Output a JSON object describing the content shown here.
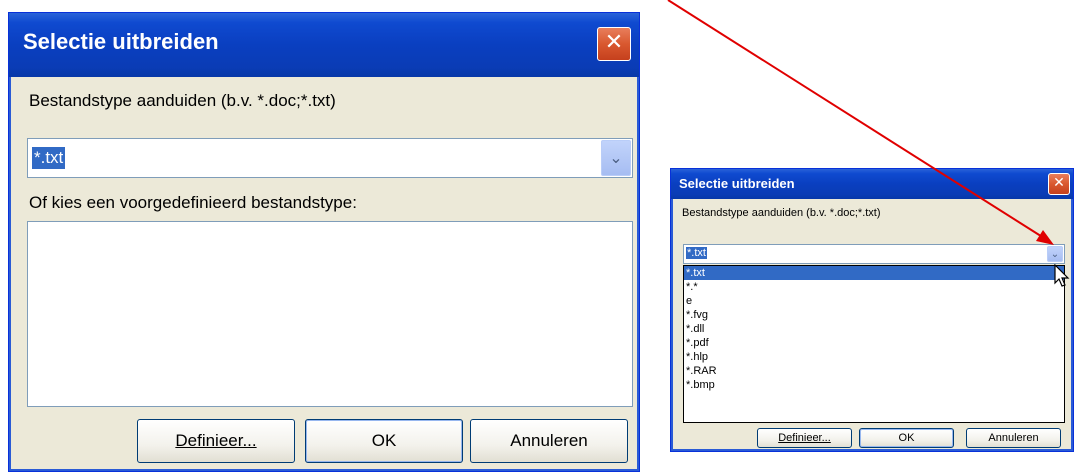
{
  "large_dialog": {
    "title": "Selectie uitbreiden",
    "close_glyph": "✕",
    "filetype_label": "Bestandstype aanduiden (b.v. *.doc;*.txt)",
    "filetype_value": "*.txt",
    "dropdown_glyph": "⌄",
    "predefined_label": "Of kies een voorgedefinieerd bestandstype:",
    "buttons": {
      "define": "Definieer...",
      "ok": "OK",
      "cancel": "Annuleren"
    }
  },
  "small_dialog": {
    "title": "Selectie uitbreiden",
    "close_glyph": "✕",
    "filetype_label": "Bestandstype aanduiden (b.v. *.doc;*.txt)",
    "filetype_value": "*.txt",
    "dropdown_glyph": "⌄",
    "options": [
      "*.txt",
      "*.*",
      "e",
      "*.fvg",
      "*.dll",
      "*.pdf",
      "*.hlp",
      "*.RAR",
      "*.bmp"
    ],
    "selected_option_index": 0,
    "buttons": {
      "define": "Definieer...",
      "ok": "OK",
      "cancel": "Annuleren"
    }
  },
  "colors": {
    "titlebar": "#0a3fc0",
    "dialog_bg": "#ece9d8",
    "selection": "#316ac5",
    "annotation_arrow": "#e00000"
  },
  "icons": {
    "close": "close-icon",
    "dropdown": "chevron-down-icon",
    "cursor": "mouse-pointer-icon",
    "annotation": "red-arrow-annotation"
  }
}
